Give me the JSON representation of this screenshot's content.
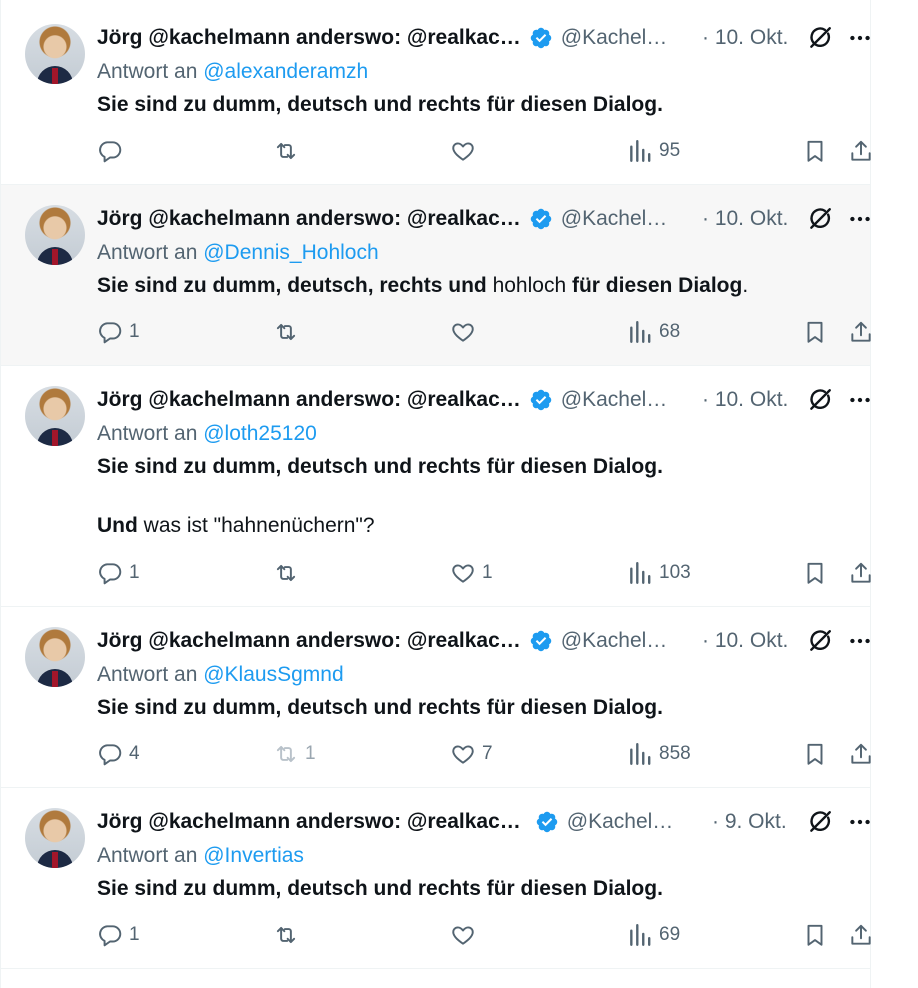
{
  "author": {
    "name": "Jörg @kachelmann anderswo: @realkac…",
    "handle": "@Kachel…",
    "verified_color": "#1d9bf0"
  },
  "reply_prefix": "Antwort an",
  "tweets": [
    {
      "date": "· 10. Okt.",
      "reply_to": "@alexanderamzh",
      "text": "Sie sind zu dumm, deutsch und rechts für diesen Dialog.",
      "replies": "",
      "retweets": "",
      "likes": "",
      "views": "95"
    },
    {
      "date": "· 10. Okt.",
      "reply_to": "@Dennis_Hohloch",
      "text_parts": [
        "Sie sind zu dumm, deutsch, rechts und",
        " hohloch ",
        "für diesen Dialog",
        "."
      ],
      "replies": "1",
      "retweets": "",
      "likes": "",
      "views": "68"
    },
    {
      "date": "· 10. Okt.",
      "reply_to": "@loth25120",
      "text": "Sie sind zu dumm, deutsch und rechts für diesen Dialog.",
      "text2_parts": [
        "Und",
        " was ist \"hahnenüchern\"?"
      ],
      "replies": "1",
      "retweets": "",
      "likes": "1",
      "views": "103"
    },
    {
      "date": "· 10. Okt.",
      "reply_to": "@KlausSgmnd",
      "text": "Sie sind zu dumm, deutsch und rechts für diesen Dialog.",
      "replies": "4",
      "retweets": "1",
      "likes": "7",
      "views": "858"
    },
    {
      "date": "· 9. Okt.",
      "reply_to": "@Invertias",
      "text": "Sie sind zu dumm, deutsch und rechts für diesen Dialog.",
      "replies": "1",
      "retweets": "",
      "likes": "",
      "views": "69"
    }
  ]
}
